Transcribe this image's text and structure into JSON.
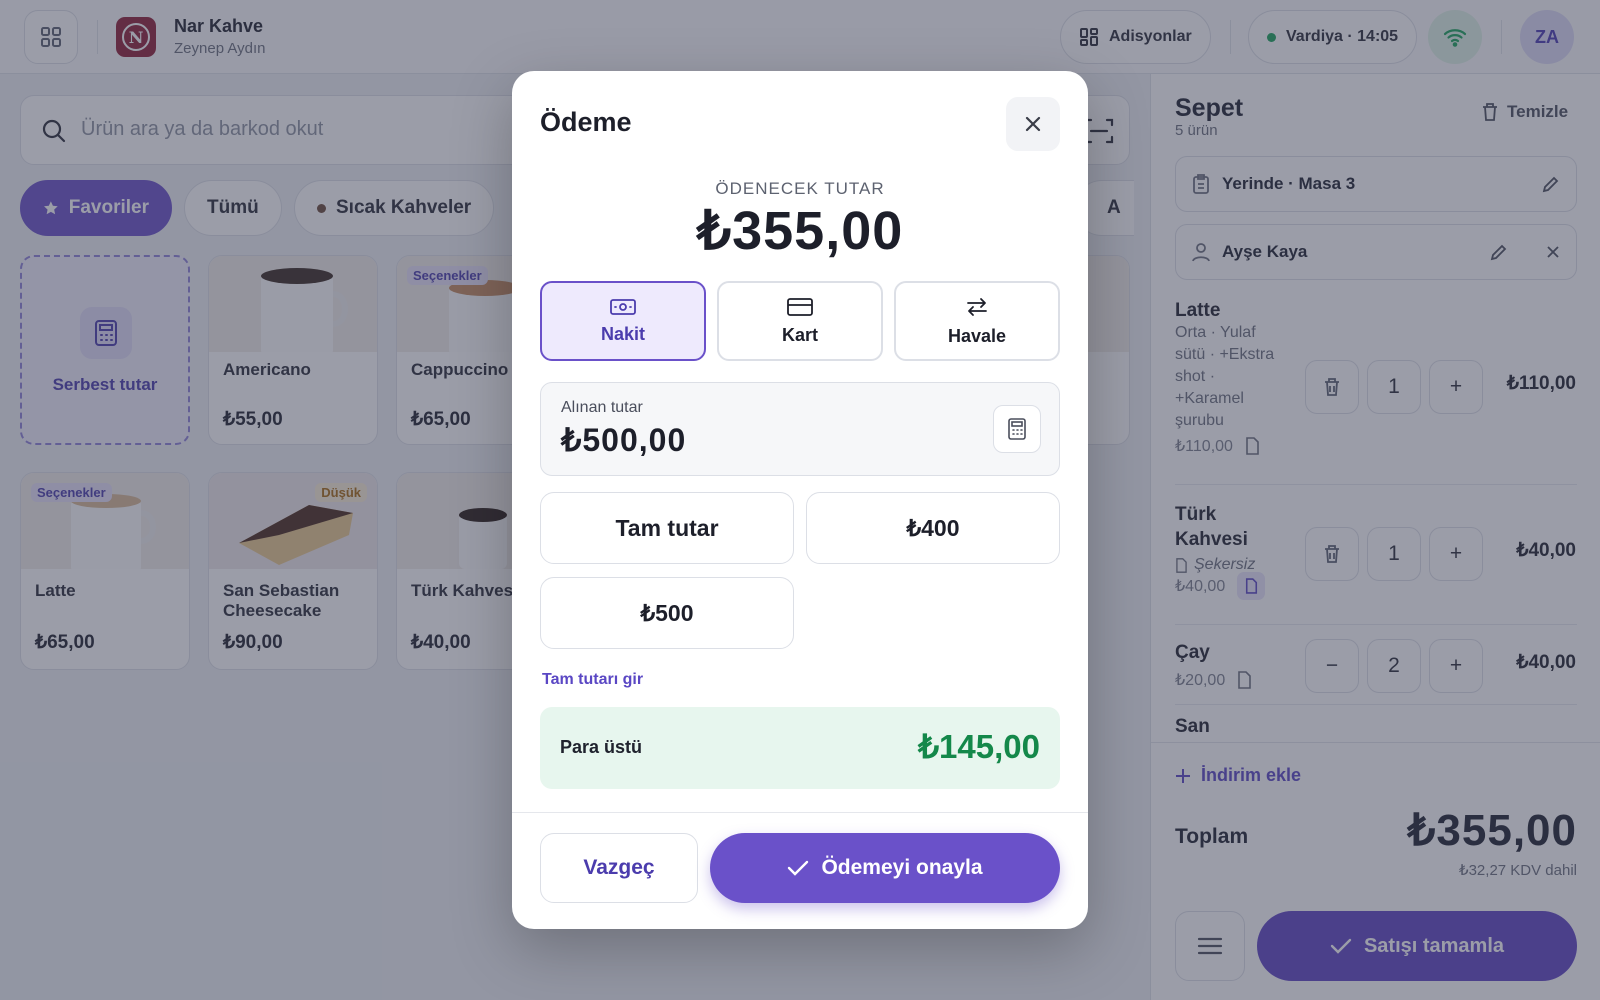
{
  "header": {
    "brand_initial": "N",
    "brand_name": "Nar Kahve",
    "user_name": "Zeynep Aydın",
    "adisyonlar_label": "Adisyonlar",
    "shift_label": "Vardiya · 14:05",
    "avatar_initials": "ZA"
  },
  "search": {
    "placeholder": "Ürün ara ya da barkod okut"
  },
  "categories": [
    {
      "label": "Favoriler",
      "active": true
    },
    {
      "label": "Tümü",
      "active": false
    },
    {
      "label": "Sıcak Kahveler",
      "active": false,
      "dot_color": "#6b4a3a"
    },
    {
      "label": "A",
      "active": false,
      "dot_color": "#e0892b"
    }
  ],
  "products": {
    "custom_label": "Serbest tutar",
    "items": [
      {
        "name": "Americano",
        "price": "₺55,00"
      },
      {
        "name": "Cappuccino",
        "price": "₺65,00",
        "tag": "Seçenekler"
      },
      {
        "name": "Latte",
        "price": "₺65,00",
        "tag": "Seçenekler"
      },
      {
        "name": "San Sebastian Cheesecake",
        "price": "₺90,00",
        "tag": "Düşük"
      },
      {
        "name": "Türk Kahvesi",
        "price": "₺40,00"
      }
    ]
  },
  "cart": {
    "title": "Sepet",
    "count": "5 ürün",
    "clear_label": "Temizle",
    "table_label": "Yerinde · Masa 3",
    "customer_name": "Ayşe Kaya",
    "items": [
      {
        "name": "Latte",
        "options": "Orta · Yulaf sütü · +Ekstra shot · +Karamel şurubu",
        "unit_price": "₺110,00",
        "qty": "1",
        "total": "₺110,00"
      },
      {
        "name": "Türk Kahvesi",
        "note": "Şekersiz",
        "unit_price": "₺40,00",
        "qty": "1",
        "total": "₺40,00"
      },
      {
        "name": "Çay",
        "unit_price": "₺20,00",
        "qty": "2",
        "total": "₺40,00"
      },
      {
        "name": "San Sebastian"
      }
    ],
    "discount_label": "İndirim ekle",
    "total_label": "Toplam",
    "total_value": "₺355,00",
    "vat_note": "₺32,27 KDV dahil",
    "complete_label": "Satışı tamamla"
  },
  "payment_modal": {
    "title": "Ödeme",
    "due_label": "ÖDENECEK TUTAR",
    "due_value": "₺355,00",
    "methods": [
      {
        "label": "Nakit",
        "selected": true
      },
      {
        "label": "Kart",
        "selected": false
      },
      {
        "label": "Havale",
        "selected": false
      }
    ],
    "received_label": "Alınan tutar",
    "received_value": "₺500,00",
    "quick_amounts": [
      "Tam tutar",
      "₺400",
      "₺500"
    ],
    "exact_link": "Tam tutarı gir",
    "change_label": "Para üstü",
    "change_value": "₺145,00",
    "cancel_label": "Vazgeç",
    "confirm_label": "Ödemeyi onayla"
  },
  "colors": {
    "accent": "#6a51c9",
    "brand": "#8e1f36",
    "success": "#14884a",
    "online": "#1aa35a"
  }
}
